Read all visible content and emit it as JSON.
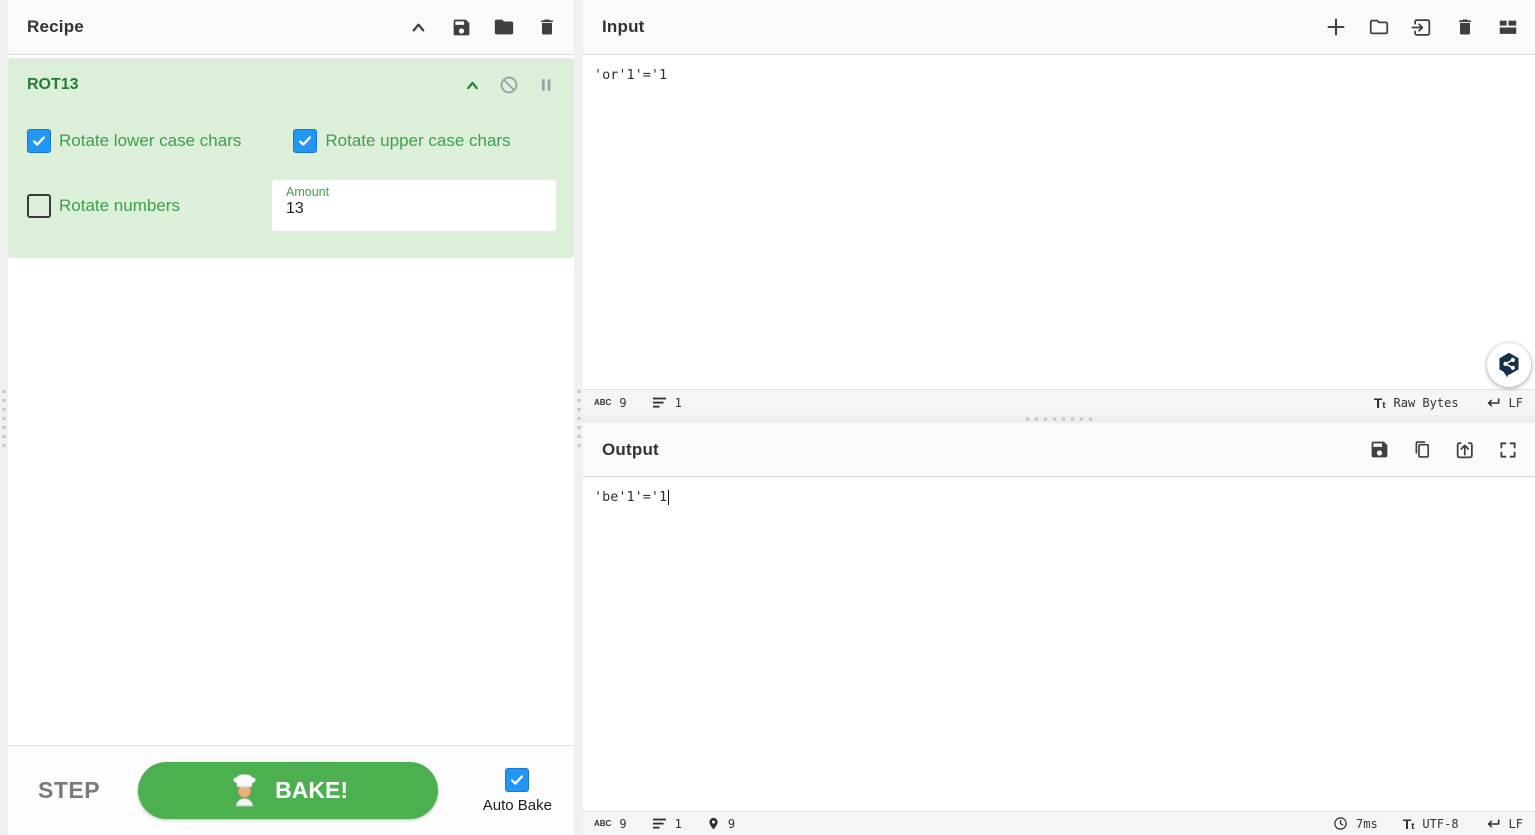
{
  "colors": {
    "accent_green": "#4caf50",
    "card_green": "#dcefd8",
    "op_title_green": "#257a38",
    "arg_label_green": "#3f9e4f",
    "checkbox_blue": "#2196f3",
    "widget_navy": "#14304a"
  },
  "recipe": {
    "title": "Recipe",
    "operation": {
      "name": "ROT13",
      "args": [
        {
          "label": "Rotate lower case chars",
          "checked": true
        },
        {
          "label": "Rotate upper case chars",
          "checked": true
        },
        {
          "label": "Rotate numbers",
          "checked": false
        }
      ],
      "amount": {
        "label": "Amount",
        "value": "13"
      }
    },
    "controls": {
      "step": "STEP",
      "bake": "BAKE!",
      "auto_bake": "Auto Bake"
    }
  },
  "input": {
    "title": "Input",
    "text": "'or'1'='1",
    "status": {
      "char_count_icon": "ABC",
      "char_count": "9",
      "line_count": "1",
      "encoding_icon": "Tt",
      "encoding": "Raw Bytes",
      "eol": "LF"
    }
  },
  "output": {
    "title": "Output",
    "text": "'be'1'='1",
    "status": {
      "char_count_icon": "ABC",
      "char_count": "9",
      "line_count": "1",
      "cursor_pos": "9",
      "bake_time": "7ms",
      "encoding_icon": "Tt",
      "encoding": "UTF-8",
      "eol": "LF"
    }
  }
}
